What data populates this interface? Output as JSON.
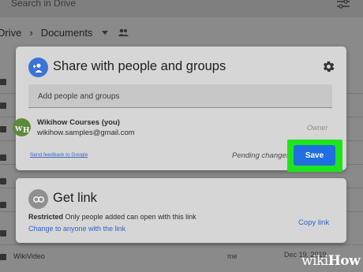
{
  "background": {
    "search_placeholder": "Search in Drive",
    "breadcrumb": [
      "Drive",
      "Documents"
    ],
    "rows": [
      {
        "name": "WikiVideo",
        "owner": "me",
        "date": "Dec 19, 2019"
      }
    ]
  },
  "share_dialog": {
    "title": "Share with people and groups",
    "add_placeholder": "Add people and groups",
    "user": {
      "name": "Wikihow Courses (you)",
      "email": "wikihow.samples@gmail.com",
      "role": "Owner"
    },
    "feedback_link": "Send feedback to Google",
    "pending_text": "Pending changes",
    "save_label": "Save"
  },
  "get_link": {
    "title": "Get link",
    "restricted_label": "Restricted",
    "restricted_desc": "Only people added can open with this link",
    "change_link": "Change to anyone with the link",
    "copy_link": "Copy link"
  },
  "watermark": {
    "prefix": "wiki",
    "suffix": "How"
  },
  "colors": {
    "accent": "#1f6fe0",
    "highlight": "#1ee41e",
    "link": "#2f63c7"
  }
}
